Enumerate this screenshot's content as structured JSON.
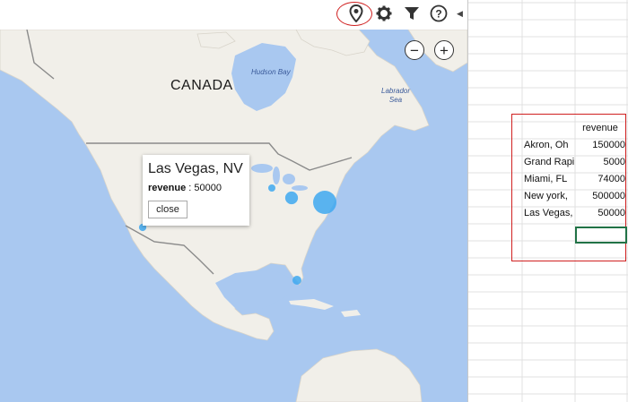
{
  "toolbar": {
    "icons": [
      "map-pin-icon",
      "gear-icon",
      "filter-icon",
      "help-icon"
    ],
    "highlight_color": "#d02020"
  },
  "map": {
    "zoom_out_label": "−",
    "zoom_in_label": "+",
    "labels": {
      "country": "CANADA",
      "hudson_bay": "Hudson Bay",
      "labrador_sea_1": "Labrador",
      "labrador_sea_2": "Sea"
    },
    "colors": {
      "water": "#a9c8f0",
      "land": "#f1efe9",
      "bubble": "#3ea8f0"
    },
    "bubbles": [
      {
        "city": "Akron, Oh",
        "value": 150000
      },
      {
        "city": "Grand Rapids",
        "value": 5000
      },
      {
        "city": "Miami, FL",
        "value": 74000
      },
      {
        "city": "New york",
        "value": 500000
      },
      {
        "city": "Las Vegas",
        "value": 50000
      }
    ]
  },
  "popup": {
    "title": "Las Vegas, NV",
    "field": "revenue",
    "separator": " : ",
    "value": "50000",
    "close_label": "close"
  },
  "sheet": {
    "header": "revenue",
    "rows": [
      {
        "name": "Akron, Oh",
        "value": "150000"
      },
      {
        "name": "Grand Rapi",
        "value": "5000"
      },
      {
        "name": "Miami, FL",
        "value": "74000"
      },
      {
        "name": "New york,",
        "value": "500000"
      },
      {
        "name": "Las Vegas,",
        "value": "50000"
      }
    ],
    "selection_color": "#217346"
  }
}
